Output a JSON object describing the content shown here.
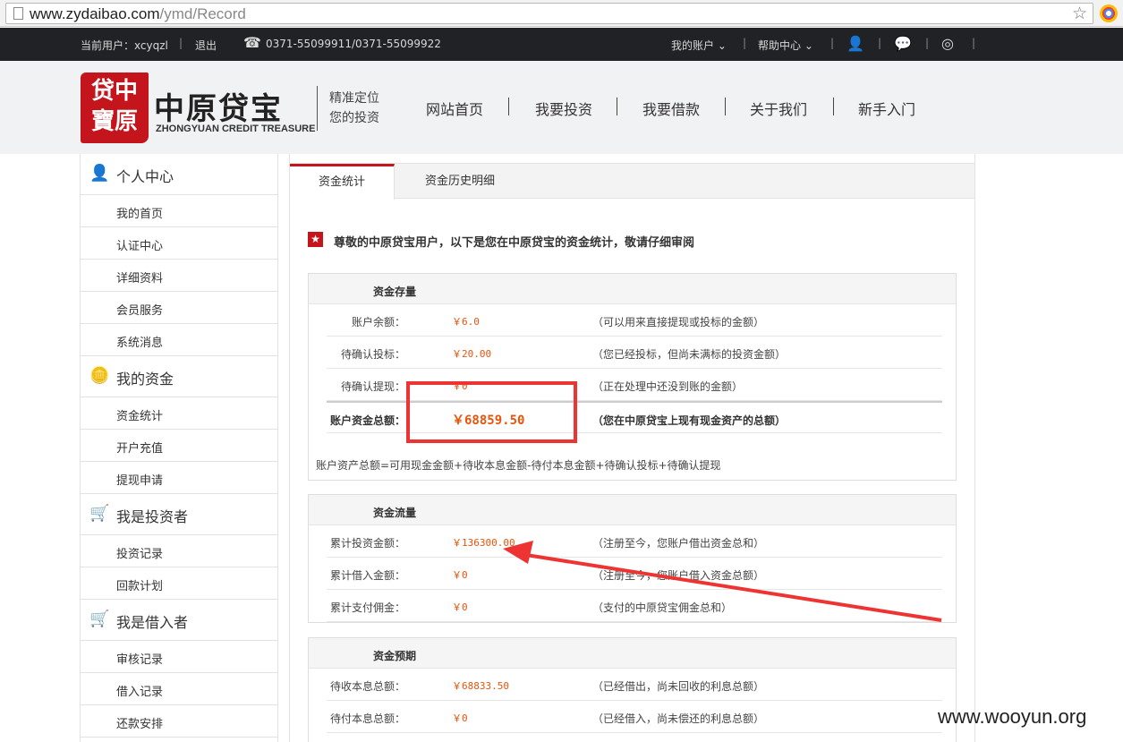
{
  "browser": {
    "url_host": "www.zydaibao.com",
    "url_path": "/ymd/Record"
  },
  "topbar": {
    "current_user": "当前用户：xcyqzl",
    "logout": "退出",
    "phone": "0371-55099911/0371-55099922",
    "my_account": "我的账户",
    "help_center": "帮助中心"
  },
  "header": {
    "seal_text": [
      "贷中",
      "寶原"
    ],
    "logo_name": "中原贷宝",
    "logo_sub": "ZHONGYUAN CREDIT TREASURE",
    "slogan_line1": "精准定位",
    "slogan_line2": "您的投资",
    "nav": [
      "网站首页",
      "我要投资",
      "我要借款",
      "关于我们",
      "新手入门"
    ]
  },
  "sidebar": {
    "sections": [
      {
        "title": "个人中心",
        "icon": "user-icon",
        "items": [
          "我的首页",
          "认证中心",
          "详细资料",
          "会员服务",
          "系统消息"
        ]
      },
      {
        "title": "我的资金",
        "icon": "coins-icon",
        "items": [
          "资金统计",
          "开户充值",
          "提现申请"
        ]
      },
      {
        "title": "我是投资者",
        "icon": "cart-icon",
        "items": [
          "投资记录",
          "回款计划"
        ]
      },
      {
        "title": "我是借入者",
        "icon": "cart-icon",
        "items": [
          "审核记录",
          "借入记录",
          "还款安排"
        ]
      }
    ]
  },
  "tabs": [
    "资金统计",
    "资金历史明细"
  ],
  "intro": "尊敬的中原贷宝用户，以下是您在中原贷宝的资金统计，敬请仔细审阅",
  "boxes": {
    "stock": {
      "title": "资金存量",
      "rows": [
        {
          "k": "账户余额：",
          "v": "￥6.0",
          "d": "（可以用来直接提现或投标的金额）"
        },
        {
          "k": "待确认投标：",
          "v": "￥20.00",
          "d": "（您已经投标，但尚未满标的投资金额）"
        },
        {
          "k": "待确认提现：",
          "v": "￥0",
          "d": "（正在处理中还没到账的金额）"
        },
        {
          "k": "账户资金总额：",
          "v": "￥68859.50",
          "d": "（您在中原贷宝上现有现金资产的总额）"
        }
      ],
      "note": "账户资产总额=可用现金金额+待收本息金额-待付本息金额+待确认投标+待确认提现"
    },
    "flow": {
      "title": "资金流量",
      "rows": [
        {
          "k": "累计投资金额：",
          "v": "￥136300.00",
          "d": "（注册至今，您账户借出资金总和）"
        },
        {
          "k": "累计借入金额：",
          "v": "￥0",
          "d": "（注册至今，您账户借入资金总额）"
        },
        {
          "k": "累计支付佣金：",
          "v": "￥0",
          "d": "（支付的中原贷宝佣金总和）"
        }
      ]
    },
    "forecast": {
      "title": "资金预期",
      "rows": [
        {
          "k": "待收本息总额：",
          "v": "￥68833.50",
          "d": "（已经借出，尚未回收的利息总额）"
        },
        {
          "k": "待付本息总额：",
          "v": "￥0",
          "d": "（已经借入，尚未偿还的利息总额）"
        }
      ]
    }
  },
  "watermark": "www.wooyun.org"
}
